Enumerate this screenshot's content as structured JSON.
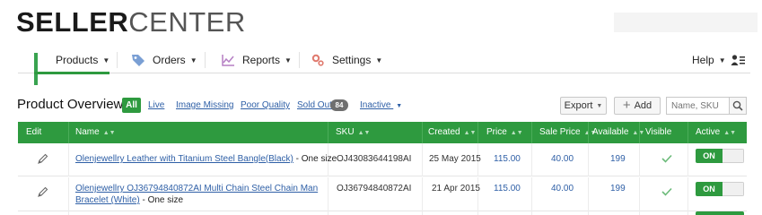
{
  "app": {
    "logo_bold": "SELLER",
    "logo_light": "CENTER"
  },
  "nav": {
    "items": [
      {
        "label": "Products",
        "icon": "grid-icon"
      },
      {
        "label": "Orders",
        "icon": "tag-icon"
      },
      {
        "label": "Reports",
        "icon": "chart-icon"
      },
      {
        "label": "Settings",
        "icon": "gear-icon"
      }
    ],
    "help": "Help"
  },
  "overview": {
    "title": "Product Overview",
    "filters": {
      "all": "All",
      "live": "Live",
      "image_missing": "Image Missing",
      "poor_quality": "Poor Quality",
      "sold_out": "Sold Out",
      "sold_out_count": "84",
      "inactive": "Inactive"
    },
    "export": "Export",
    "add": "Add",
    "search_placeholder": "Name, SKU"
  },
  "table": {
    "headers": {
      "edit": "Edit",
      "name": "Name",
      "sku": "SKU",
      "created": "Created",
      "price": "Price",
      "sale_price": "Sale Price",
      "available": "Available",
      "visible": "Visible",
      "active": "Active"
    },
    "rows": [
      {
        "name_link": "Olenjewellry Leather with Titanium Steel Bangle(Black)",
        "name_suffix": " - One size",
        "sku": "OJ43083644198AI",
        "created": "25 May 2015",
        "price": "115.00",
        "sale_price": "40.00",
        "available": "199",
        "active": "ON"
      },
      {
        "name_link_1": "Olenjewellry OJ36794840872AI Multi Chain Steel Chain Man",
        "name_link_2": "Bracelet (White)",
        "name_suffix": " - One size",
        "sku": "OJ36794840872AI",
        "created": "21 Apr 2015",
        "price": "115.00",
        "sale_price": "40.00",
        "available": "199",
        "active": "ON"
      }
    ]
  },
  "colors": {
    "accent": "#2e9a3f",
    "link": "#2e5fa6"
  }
}
